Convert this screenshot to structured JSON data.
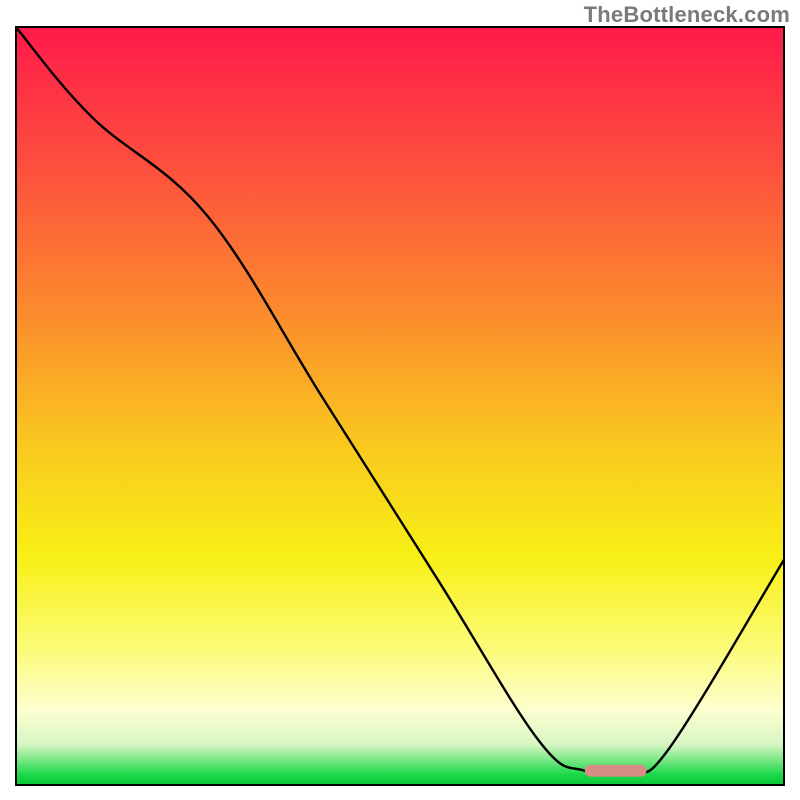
{
  "watermark": "TheBottleneck.com",
  "chart_data": {
    "type": "line",
    "title": "",
    "xlabel": "",
    "ylabel": "",
    "xlim": [
      0,
      100
    ],
    "ylim": [
      0,
      100
    ],
    "grid": false,
    "series": [
      {
        "name": "bottleneck-curve",
        "x": [
          0,
          10,
          25,
          40,
          55,
          68,
          74,
          80,
          85,
          100
        ],
        "values": [
          100,
          88,
          75,
          51,
          27,
          6,
          2,
          2,
          5,
          30
        ]
      }
    ],
    "highlight_segment": {
      "name": "optimal-range",
      "x_start": 74,
      "x_end": 82,
      "y": 2,
      "color": "#d98b86"
    },
    "background_gradient": {
      "stops": [
        {
          "offset": 0.0,
          "color": "#fe1a4b"
        },
        {
          "offset": 0.18,
          "color": "#fd4e3e"
        },
        {
          "offset": 0.38,
          "color": "#fb8c2d"
        },
        {
          "offset": 0.55,
          "color": "#f9c81f"
        },
        {
          "offset": 0.7,
          "color": "#f8f016"
        },
        {
          "offset": 0.82,
          "color": "#fbfb79"
        },
        {
          "offset": 0.9,
          "color": "#fefed0"
        },
        {
          "offset": 0.945,
          "color": "#d7f6c4"
        },
        {
          "offset": 0.965,
          "color": "#7ee889"
        },
        {
          "offset": 0.985,
          "color": "#1bd94a"
        },
        {
          "offset": 1.0,
          "color": "#06c434"
        }
      ]
    }
  }
}
